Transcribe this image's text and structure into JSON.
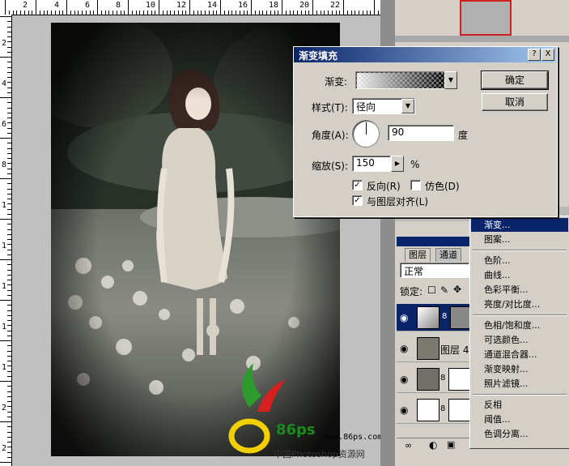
{
  "ruler": {
    "top_numbers": [
      "2",
      "4",
      "6",
      "8",
      "10",
      "12",
      "14",
      "16",
      "18",
      "20",
      "22"
    ],
    "left_numbers": [
      "2",
      "4",
      "6",
      "8",
      "1",
      "1",
      "1",
      "1",
      "1",
      "2",
      "2"
    ]
  },
  "dialog": {
    "title": "渐变填充",
    "gradient_label": "渐变:",
    "style_label": "样式(T):",
    "style_value": "径向",
    "angle_label": "角度(A):",
    "angle_value": "90",
    "angle_unit": "度",
    "scale_label": "缩放(S):",
    "scale_value": "150",
    "scale_unit": "%",
    "reverse_label": "反向(R)",
    "reverse_checked": true,
    "dither_label": "仿色(D)",
    "dither_checked": false,
    "align_label": "与图层对齐(L)",
    "align_checked": true,
    "ok_label": "确定",
    "cancel_label": "取消",
    "help_glyph": "?",
    "close_glyph": "X"
  },
  "layers_panel": {
    "tab_layers": "图层",
    "tab_channels": "通道",
    "blend_mode": "正常",
    "lock_label": "锁定:",
    "layer4_name": "图层 4"
  },
  "context_menu": {
    "items": [
      "渐变...",
      "图案...",
      "色阶...",
      "曲线...",
      "色彩平衡...",
      "亮度/对比度...",
      "色相/饱和度...",
      "可选颜色...",
      "通道混合器...",
      "渐变映射...",
      "照片滤镜...",
      "反相",
      "阈值...",
      "色调分离..."
    ],
    "highlighted": "渐变..."
  },
  "watermark": {
    "logo_text": "86ps",
    "url": "www.86ps.com",
    "site": "中国Photoshop资源网"
  },
  "colors": {
    "selection": "#0a246a",
    "dialog_bg": "#d4d0c8"
  }
}
